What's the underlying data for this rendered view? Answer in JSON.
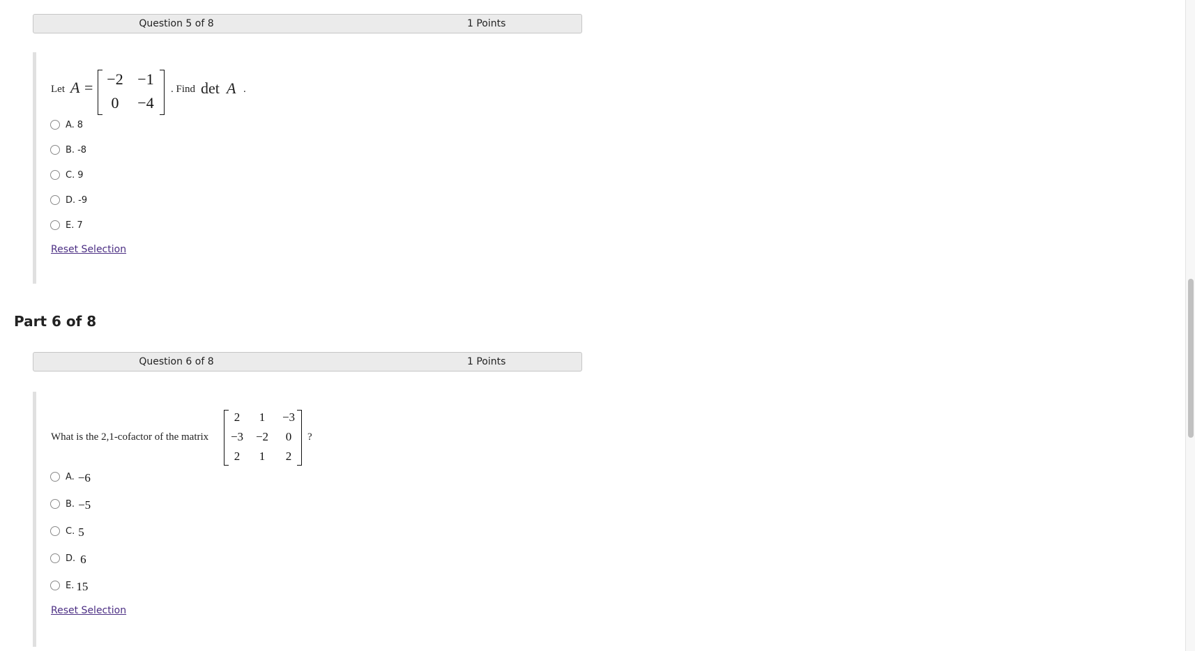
{
  "questions": [
    {
      "header": {
        "number_label": "Question 5 of 8",
        "points_label": "1 Points"
      },
      "stem": {
        "prefix": "Let",
        "variable": "A",
        "equals": "=",
        "matrix": [
          [
            "−2",
            "−1"
          ],
          [
            "0",
            "−4"
          ]
        ],
        "middle": ". Find",
        "det_word": "det",
        "det_var": "A",
        "suffix": "."
      },
      "choices": [
        {
          "letter": "A.",
          "text": "8",
          "selected": false
        },
        {
          "letter": "B.",
          "text": "-8",
          "selected": false
        },
        {
          "letter": "C.",
          "text": "9",
          "selected": false
        },
        {
          "letter": "D.",
          "text": "-9",
          "selected": false
        },
        {
          "letter": "E.",
          "text": "7",
          "selected": false
        }
      ],
      "reset_label": "Reset Selection"
    },
    {
      "part_title": "Part 6 of 8",
      "header": {
        "number_label": "Question 6 of 8",
        "points_label": "1 Points"
      },
      "stem": {
        "prefix": "What is the 2,1-cofactor of the matrix",
        "matrix": [
          [
            "2",
            "1",
            "−3"
          ],
          [
            "−3",
            "−2",
            "0"
          ],
          [
            "2",
            "1",
            "2"
          ]
        ],
        "suffix": "?"
      },
      "choices": [
        {
          "letter": "A.",
          "text": "−6",
          "selected": false
        },
        {
          "letter": "B.",
          "text": "−5",
          "selected": false
        },
        {
          "letter": "C.",
          "text": "5",
          "selected": false
        },
        {
          "letter": "D.",
          "text": "6",
          "selected": false
        },
        {
          "letter": "E.",
          "text": "15",
          "selected": false
        }
      ],
      "reset_label": "Reset Selection"
    }
  ]
}
